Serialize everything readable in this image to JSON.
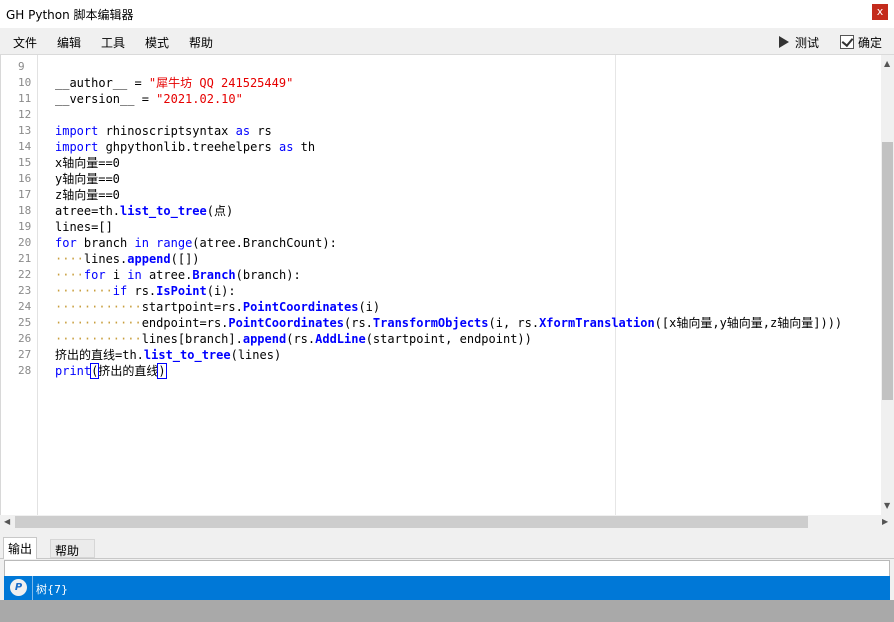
{
  "window": {
    "title": "GH Python 脚本编辑器",
    "close_glyph": "x"
  },
  "menu": {
    "items": [
      "文件",
      "编辑",
      "工具",
      "模式",
      "帮助"
    ]
  },
  "toolbar": {
    "test_label": "测试",
    "confirm_label": "确定"
  },
  "editor": {
    "lines": [
      {
        "n": "9",
        "segs": []
      },
      {
        "n": "10",
        "segs": [
          [
            "t",
            "__author__ = "
          ],
          [
            "s",
            "\"犀牛坊 QQ 241525449\""
          ]
        ]
      },
      {
        "n": "11",
        "segs": [
          [
            "t",
            "__version__ = "
          ],
          [
            "s",
            "\"2021.02.10\""
          ]
        ]
      },
      {
        "n": "12",
        "segs": []
      },
      {
        "n": "13",
        "segs": [
          [
            "k",
            "import"
          ],
          [
            "t",
            " rhinoscriptsyntax "
          ],
          [
            "k",
            "as"
          ],
          [
            "t",
            " rs"
          ]
        ]
      },
      {
        "n": "14",
        "segs": [
          [
            "k",
            "import"
          ],
          [
            "t",
            " ghpythonlib.treehelpers "
          ],
          [
            "k",
            "as"
          ],
          [
            "t",
            " th"
          ]
        ]
      },
      {
        "n": "15",
        "segs": [
          [
            "t",
            "x轴向量==0"
          ]
        ]
      },
      {
        "n": "16",
        "segs": [
          [
            "t",
            "y轴向量==0"
          ]
        ]
      },
      {
        "n": "17",
        "segs": [
          [
            "t",
            "z轴向量==0"
          ]
        ]
      },
      {
        "n": "18",
        "segs": [
          [
            "t",
            "atree=th."
          ],
          [
            "f",
            "list_to_tree"
          ],
          [
            "t",
            "(点)"
          ]
        ]
      },
      {
        "n": "19",
        "segs": [
          [
            "t",
            "lines=[]"
          ]
        ]
      },
      {
        "n": "20",
        "segs": [
          [
            "k",
            "for"
          ],
          [
            "t",
            " branch "
          ],
          [
            "k",
            "in"
          ],
          [
            "t",
            " "
          ],
          [
            "k",
            "range"
          ],
          [
            "t",
            "(atree.BranchCount):"
          ]
        ]
      },
      {
        "n": "21",
        "segs": [
          [
            "w",
            "····"
          ],
          [
            "t",
            "lines."
          ],
          [
            "f",
            "append"
          ],
          [
            "t",
            "([])"
          ]
        ]
      },
      {
        "n": "22",
        "segs": [
          [
            "w",
            "····"
          ],
          [
            "k",
            "for"
          ],
          [
            "t",
            " i "
          ],
          [
            "k",
            "in"
          ],
          [
            "t",
            " atree."
          ],
          [
            "f",
            "Branch"
          ],
          [
            "t",
            "(branch):"
          ]
        ]
      },
      {
        "n": "23",
        "segs": [
          [
            "w",
            "········"
          ],
          [
            "k",
            "if"
          ],
          [
            "t",
            " rs."
          ],
          [
            "f",
            "IsPoint"
          ],
          [
            "t",
            "(i):"
          ]
        ]
      },
      {
        "n": "24",
        "segs": [
          [
            "w",
            "············"
          ],
          [
            "t",
            "startpoint=rs."
          ],
          [
            "f",
            "PointCoordinates"
          ],
          [
            "t",
            "(i)"
          ]
        ]
      },
      {
        "n": "25",
        "segs": [
          [
            "w",
            "············"
          ],
          [
            "t",
            "endpoint=rs."
          ],
          [
            "f",
            "PointCoordinates"
          ],
          [
            "t",
            "(rs."
          ],
          [
            "f",
            "TransformObjects"
          ],
          [
            "t",
            "(i, rs."
          ],
          [
            "f",
            "XformTranslation"
          ],
          [
            "t",
            "([x轴向量,y轴向量,z轴向量])))"
          ]
        ]
      },
      {
        "n": "26",
        "segs": [
          [
            "w",
            "············"
          ],
          [
            "t",
            "lines[branch]."
          ],
          [
            "f",
            "append"
          ],
          [
            "t",
            "(rs."
          ],
          [
            "f",
            "AddLine"
          ],
          [
            "t",
            "(startpoint, endpoint))"
          ]
        ]
      },
      {
        "n": "27",
        "segs": [
          [
            "t",
            "挤出的直线=th."
          ],
          [
            "f",
            "list_to_tree"
          ],
          [
            "t",
            "(lines)"
          ]
        ]
      },
      {
        "n": "28",
        "segs": [
          [
            "k",
            "print"
          ],
          [
            "b",
            "("
          ],
          [
            "t",
            "挤出的直线"
          ],
          [
            "b",
            ")"
          ]
        ]
      }
    ]
  },
  "bottom_tabs": {
    "output_label": "输出",
    "help_label": "帮助"
  },
  "output": {
    "icon_letter": "P",
    "text": "树{7}"
  },
  "colors": {
    "keyword": "#0000ff",
    "string": "#e60000",
    "whitespace_marker": "#c89e3c",
    "selection": "#0078d7"
  }
}
